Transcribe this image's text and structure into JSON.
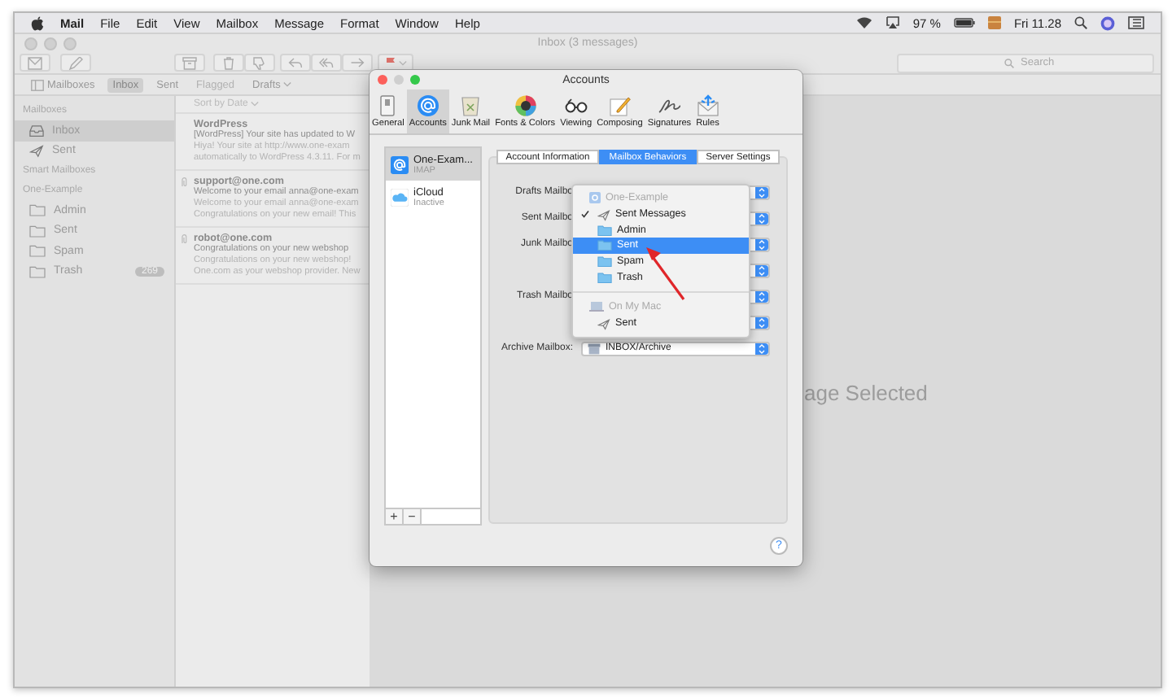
{
  "menubar": {
    "menus": [
      {
        "label": "Mail",
        "kind": "app"
      },
      {
        "label": "File",
        "kind": "menu"
      },
      {
        "label": "Edit",
        "kind": "menu"
      },
      {
        "label": "View",
        "kind": "menu"
      },
      {
        "label": "Mailbox",
        "kind": "menu"
      },
      {
        "label": "Message",
        "kind": "menu"
      },
      {
        "label": "Format",
        "kind": "menu"
      },
      {
        "label": "Window",
        "kind": "menu"
      },
      {
        "label": "Help",
        "kind": "menu"
      }
    ],
    "battery": "97 %",
    "clock": "Fri 11.28"
  },
  "mail_window": {
    "title": "Inbox (3 messages)",
    "search": {
      "placeholder": "Search"
    },
    "favorites": [
      {
        "label": "Mailboxes",
        "kind": "toggle",
        "selected": false,
        "disabled": false
      },
      {
        "label": "Inbox",
        "kind": "mailbox",
        "selected": true,
        "disabled": false
      },
      {
        "label": "Sent",
        "kind": "mailbox",
        "selected": false,
        "disabled": false
      },
      {
        "label": "Flagged",
        "kind": "mailbox",
        "selected": false,
        "disabled": true
      },
      {
        "label": "Drafts",
        "kind": "menu",
        "selected": false,
        "disabled": false
      }
    ],
    "sidebar": [
      {
        "title": "Mailboxes",
        "items": [
          {
            "label": "Inbox",
            "kind": "inbox",
            "selected": true
          },
          {
            "label": "Sent",
            "kind": "sent",
            "selected": false
          }
        ]
      },
      {
        "title": "Smart Mailboxes"
      },
      {
        "title": "One-Example",
        "items": [
          {
            "label": "Admin",
            "kind": "folder",
            "selected": false
          },
          {
            "label": "Sent",
            "kind": "folder",
            "selected": false
          },
          {
            "label": "Spam",
            "kind": "folder",
            "selected": false
          },
          {
            "label": "Trash",
            "kind": "folder",
            "selected": false,
            "badge": "269"
          }
        ]
      }
    ],
    "sort": "Sort by Date",
    "messages": [
      {
        "sender": "WordPress",
        "subject": "[WordPress] Your site has updated to W",
        "preview": [
          "Hiya! Your site at http://www.one-exam",
          "automatically to WordPress 4.3.11. For m"
        ],
        "attachment": false
      },
      {
        "sender": "support@one.com",
        "subject": "Welcome to your email anna@one-exam",
        "preview": [
          "Welcome to your email anna@one-exam",
          "Congratulations on your new email! This"
        ],
        "attachment": true
      },
      {
        "sender": "robot@one.com",
        "subject": "Congratulations on your new webshop",
        "preview": [
          "Congratulations on your new webshop!",
          "One.com as your webshop provider. New"
        ],
        "attachment": true
      }
    ],
    "empty_text": "age Selected"
  },
  "accounts_window": {
    "title": "Accounts",
    "toolbar": [
      {
        "label": "General",
        "kind": "general",
        "selected": false
      },
      {
        "label": "Accounts",
        "kind": "accounts",
        "selected": true
      },
      {
        "label": "Junk Mail",
        "kind": "junk",
        "selected": false
      },
      {
        "label": "Fonts & Colors",
        "kind": "fonts",
        "selected": false
      },
      {
        "label": "Viewing",
        "kind": "viewing",
        "selected": false
      },
      {
        "label": "Composing",
        "kind": "composing",
        "selected": false
      },
      {
        "label": "Signatures",
        "kind": "signatures",
        "selected": false
      },
      {
        "label": "Rules",
        "kind": "rules",
        "selected": false
      }
    ],
    "accounts": [
      {
        "name": "One-Exam...",
        "status": "IMAP",
        "kind": "imap",
        "selected": true
      },
      {
        "name": "iCloud",
        "status": "Inactive",
        "kind": "icloud",
        "selected": false
      }
    ],
    "list_buttons": [
      "+",
      "−"
    ],
    "tabs": [
      {
        "label": "Account Information",
        "selected": false
      },
      {
        "label": "Mailbox Behaviors",
        "selected": true
      },
      {
        "label": "Server Settings",
        "selected": false
      }
    ],
    "rows": [
      {
        "label": "Drafts Mailbo"
      },
      {
        "label": "Sent Mailbo"
      },
      {
        "label": "Junk Mailbo"
      },
      {},
      {
        "label": "Trash Mailbo"
      },
      {},
      {
        "label": "Archive Mailbox:",
        "value": "INBOX/Archive"
      }
    ],
    "menu": [
      {
        "kind": "account",
        "label": "One-Example"
      },
      {
        "kind": "sent",
        "label": "Sent Messages",
        "checked": true,
        "selected": false
      },
      {
        "kind": "folder",
        "label": "Admin",
        "checked": false,
        "selected": false
      },
      {
        "kind": "folder",
        "label": "Sent",
        "checked": false,
        "selected": true
      },
      {
        "kind": "folder",
        "label": "Spam",
        "checked": false,
        "selected": false
      },
      {
        "kind": "folder",
        "label": "Trash",
        "checked": false,
        "selected": false
      },
      {
        "kind": "separator"
      },
      {
        "kind": "computer",
        "label": "On My Mac"
      },
      {
        "kind": "sent",
        "label": "Sent",
        "checked": false,
        "selected": false
      }
    ],
    "help": "?"
  }
}
